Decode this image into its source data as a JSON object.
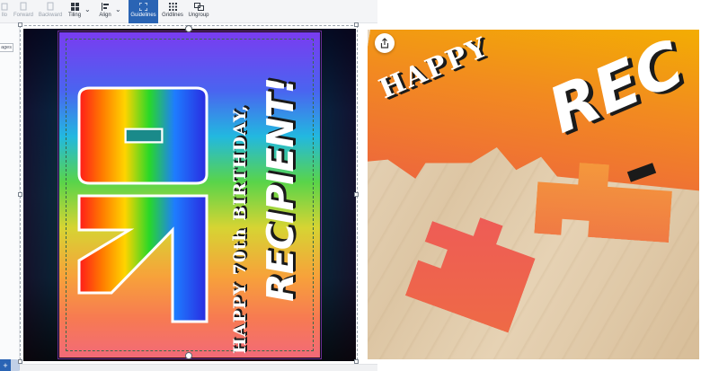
{
  "toolbar": {
    "items": [
      {
        "label": "llo"
      },
      {
        "label": "Forward"
      },
      {
        "label": "Backward"
      },
      {
        "label": "Tiling"
      },
      {
        "label": "Align"
      },
      {
        "label": "Guidelines"
      },
      {
        "label": "Gridlines"
      },
      {
        "label": "Ungroup"
      }
    ],
    "active": "Guidelines"
  },
  "sidebar": {
    "pages_tab": "ages",
    "add_button": "+"
  },
  "design": {
    "number": "70",
    "line1": "HAPPY 70th BIRTHDAY,",
    "line2": "RECIPIENT!"
  },
  "preview": {
    "text1": "HAPPY",
    "text2": "REC",
    "share_icon": "share-icon"
  },
  "colors": {
    "accent": "#2a64b4",
    "bleed": "#6b2c93",
    "safe": "#3a6a4a"
  }
}
